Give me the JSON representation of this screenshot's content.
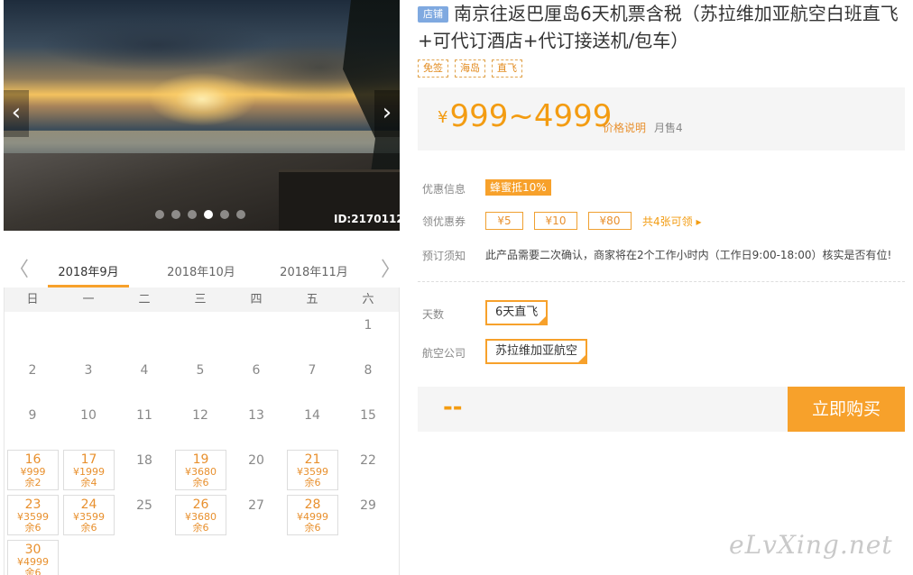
{
  "hero": {
    "image_id": "ID:2170112",
    "prev_icon": "chevron-left-icon",
    "next_icon": "chevron-right-icon",
    "dot_count": 6,
    "active_dot": 4
  },
  "calendar": {
    "prev_glyph": "〈",
    "next_glyph": "〉",
    "months": [
      "2018年9月",
      "2018年10月",
      "2018年11月"
    ],
    "active_month": 0,
    "weekdays": [
      "日",
      "一",
      "二",
      "三",
      "四",
      "五",
      "六"
    ],
    "first_weekday": 6,
    "days": [
      {
        "d": "1"
      },
      {
        "d": "2"
      },
      {
        "d": "3"
      },
      {
        "d": "4"
      },
      {
        "d": "5"
      },
      {
        "d": "6"
      },
      {
        "d": "7"
      },
      {
        "d": "8"
      },
      {
        "d": "9"
      },
      {
        "d": "10"
      },
      {
        "d": "11"
      },
      {
        "d": "12"
      },
      {
        "d": "13"
      },
      {
        "d": "14"
      },
      {
        "d": "15"
      },
      {
        "d": "16",
        "price": "¥999",
        "remain": "余2"
      },
      {
        "d": "17",
        "price": "¥1999",
        "remain": "余4"
      },
      {
        "d": "18"
      },
      {
        "d": "19",
        "price": "¥3680",
        "remain": "余6"
      },
      {
        "d": "20"
      },
      {
        "d": "21",
        "price": "¥3599",
        "remain": "余6"
      },
      {
        "d": "22"
      },
      {
        "d": "23",
        "price": "¥3599",
        "remain": "余6"
      },
      {
        "d": "24",
        "price": "¥3599",
        "remain": "余6"
      },
      {
        "d": "25"
      },
      {
        "d": "26",
        "price": "¥3680",
        "remain": "余6"
      },
      {
        "d": "27"
      },
      {
        "d": "28",
        "price": "¥4999",
        "remain": "余6"
      },
      {
        "d": "29"
      },
      {
        "d": "30",
        "price": "¥4999",
        "remain": "余6"
      }
    ]
  },
  "product": {
    "shop_badge": "店铺",
    "title": "南京往返巴厘岛6天机票含税（苏拉维加亚航空白班直飞+可代订酒店+代订接送机/包车）",
    "tags": [
      "免签",
      "海岛",
      "直飞"
    ],
    "price_symbol": "¥",
    "price_range": "999~4999",
    "price_note": "价格说明",
    "monthly_sales": "月售4"
  },
  "promo": {
    "discount_label": "优惠信息",
    "discount_badge": "蜂蜜抵10%",
    "coupon_label": "领优惠券",
    "coupons": [
      "¥5",
      "¥10",
      "¥80"
    ],
    "coupon_more": "共4张可领 ▸",
    "notice_label": "预订须知",
    "notice_text": "此产品需要二次确认，商家将在2个工作小时内（工作日9:00-18:00）核实是否有位!"
  },
  "options": {
    "days_label": "天数",
    "days_value": "6天直飞",
    "airline_label": "航空公司",
    "airline_value": "苏拉维加亚航空"
  },
  "buy": {
    "total": "--",
    "button": "立即购买"
  },
  "watermark": "eLvXing.net",
  "colors": {
    "accent": "#f7a12b",
    "price": "#f39c12",
    "badge_blue": "#7fa9e0"
  }
}
